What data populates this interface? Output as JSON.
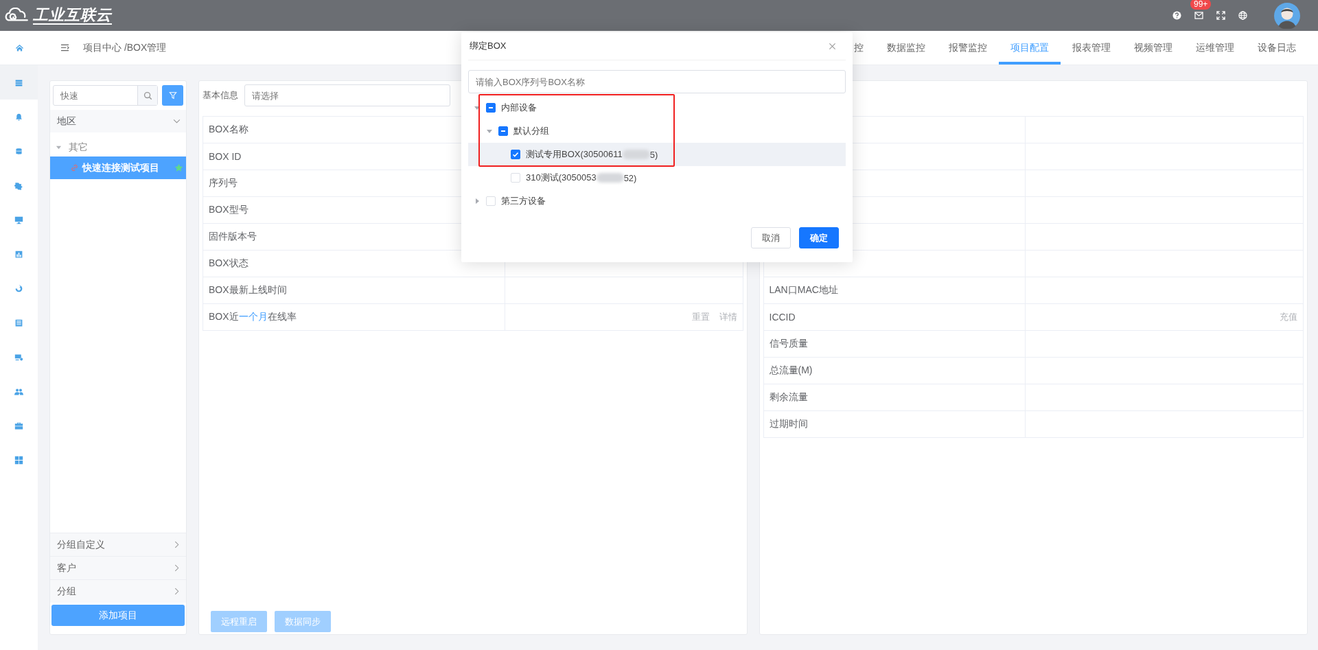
{
  "topbar": {
    "logo_text": "工业互联云",
    "mail_badge": "99+"
  },
  "header": {
    "breadcrumb": "项目中心 /BOX管理",
    "tabs": [
      {
        "label": "控",
        "selected": false
      },
      {
        "label": "数据监控",
        "selected": false
      },
      {
        "label": "报警监控",
        "selected": false
      },
      {
        "label": "项目配置",
        "selected": true
      },
      {
        "label": "报表管理",
        "selected": false
      },
      {
        "label": "视频管理",
        "selected": false
      },
      {
        "label": "运维管理",
        "selected": false
      },
      {
        "label": "设备日志",
        "selected": false
      }
    ]
  },
  "nav_rail": [
    {
      "selected": true
    },
    {
      "selected": false
    },
    {
      "selected": false
    },
    {
      "selected": false
    },
    {
      "selected": false
    },
    {
      "selected": false
    },
    {
      "selected": false
    },
    {
      "selected": false
    },
    {
      "selected": false
    },
    {
      "selected": false
    },
    {
      "selected": false
    },
    {
      "selected": false
    }
  ],
  "project_panel": {
    "search": {
      "placeholder": "快速"
    },
    "region": "地区",
    "tree": [
      {
        "label": "其它",
        "expanded": true,
        "selected": false,
        "children": [
          {
            "label": "快速连接测试项目",
            "selected": true,
            "starred": true
          }
        ]
      }
    ],
    "groups": [
      "分组自定义",
      "客户",
      "分组"
    ],
    "add_button": "添加项目"
  },
  "basic_info": {
    "label": "基本信息",
    "select": {
      "placeholder": "请选择"
    },
    "rows": [
      {
        "label": "BOX名称"
      },
      {
        "label": "BOX ID"
      },
      {
        "label": "序列号"
      },
      {
        "label": "BOX型号"
      },
      {
        "label": "固件版本号"
      },
      {
        "label": "BOX状态"
      },
      {
        "label": "BOX最新上线时间"
      },
      {
        "label": "BOX近",
        "link": "一个月",
        "label_end": "在线率",
        "actions": [
          "重置",
          "详情"
        ]
      }
    ],
    "buttons": [
      {
        "label": "远程重启",
        "disabled": true
      },
      {
        "label": "数据同步",
        "disabled": true
      }
    ]
  },
  "sim_info": {
    "rows": [
      {
        "kind": "covered"
      },
      {
        "kind": "covered"
      },
      {
        "kind": "covered"
      },
      {
        "kind": "covered"
      },
      {
        "kind": "covered"
      },
      {
        "kind": "covered"
      },
      {
        "kind": "field",
        "label": "LAN口MAC地址"
      },
      {
        "kind": "field",
        "label": "ICCID",
        "actions": [
          "充值"
        ]
      },
      {
        "kind": "field",
        "label": "信号质量"
      },
      {
        "kind": "field",
        "label": "总流量(M)"
      },
      {
        "kind": "field",
        "label": "剩余流量"
      },
      {
        "kind": "field",
        "label": "过期时间"
      }
    ]
  },
  "dialog": {
    "title": "绑定BOX",
    "search": {
      "placeholder": "请输入BOX序列号BOX名称"
    },
    "tree": [
      {
        "label": "内部设备",
        "checked": true,
        "indeterminate": true,
        "expanded": true,
        "selected": false,
        "children": [
          {
            "label": "默认分组",
            "checked": true,
            "indeterminate": true,
            "expanded": true,
            "selected": false,
            "children": [
              {
                "label": "测试专用BOX(30500611",
                "redacted": true,
                "label_end": "5)",
                "checked": true,
                "indeterminate": false,
                "selected": true
              },
              {
                "label": "310测试(3050053",
                "redacted": true,
                "label_end": "52)",
                "checked": false,
                "indeterminate": false,
                "selected": false
              }
            ]
          }
        ]
      },
      {
        "label": "第三方设备",
        "checked": false,
        "indeterminate": false,
        "expanded": false,
        "selected": false
      }
    ],
    "buttons": [
      {
        "label": "取消",
        "kind": "secondary"
      },
      {
        "label": "确定",
        "kind": "primary"
      }
    ]
  },
  "annotation": {
    "kind": "frame"
  }
}
